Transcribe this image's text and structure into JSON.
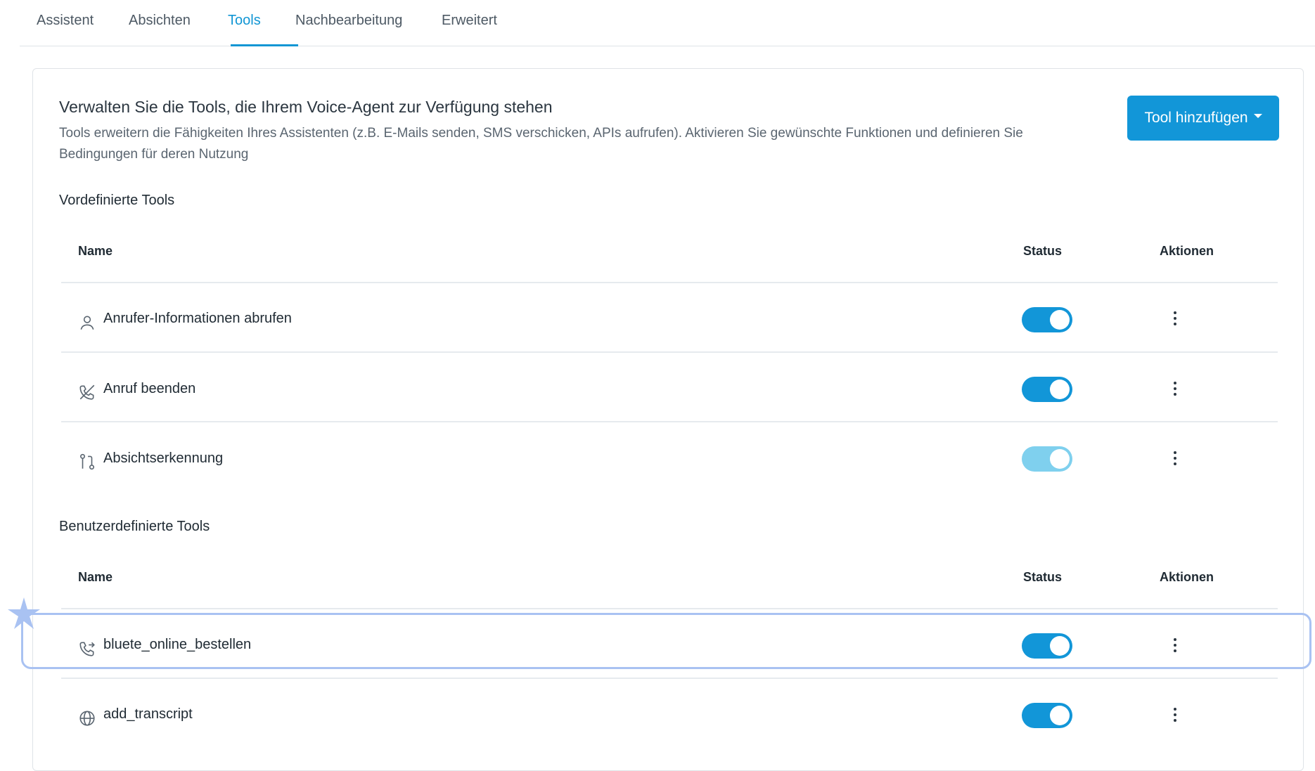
{
  "tabs": [
    {
      "label": "Assistent"
    },
    {
      "label": "Absichten"
    },
    {
      "label": "Tools",
      "active": true
    },
    {
      "label": "Nachbearbeitung"
    },
    {
      "label": "Erweitert"
    }
  ],
  "card": {
    "title": "Verwalten Sie die Tools, die Ihrem Voice-Agent zur Verfügung stehen",
    "description": "Tools erweitern die Fähigkeiten Ihres Assistenten (z.B. E-Mails senden, SMS verschicken, APIs aufrufen). Aktivieren Sie gewünschte Funktionen und definieren Sie Bedingungen für deren Nutzung",
    "add_button": "Tool hinzufügen"
  },
  "predefined": {
    "title": "Vordefinierte Tools",
    "headers": {
      "name": "Name",
      "status": "Status",
      "actions": "Aktionen"
    },
    "rows": [
      {
        "name": "Anrufer-Informationen abrufen",
        "icon": "person-icon",
        "enabled": true
      },
      {
        "name": "Anruf beenden",
        "icon": "phone-hangup-icon",
        "enabled": true
      },
      {
        "name": "Absichtserkennung",
        "icon": "branch-icon",
        "enabled": true,
        "disabled_look": true
      }
    ]
  },
  "custom": {
    "title": "Benutzerdefinierte Tools",
    "headers": {
      "name": "Name",
      "status": "Status",
      "actions": "Aktionen"
    },
    "rows": [
      {
        "name": "bluete_online_bestellen",
        "icon": "phone-forward-icon",
        "enabled": true
      },
      {
        "name": "add_transcript",
        "icon": "globe-icon",
        "enabled": true
      }
    ]
  },
  "colors": {
    "accent": "#1296d8",
    "toggle_light": "#7fd0ee",
    "highlight": "#a9c2f2"
  }
}
